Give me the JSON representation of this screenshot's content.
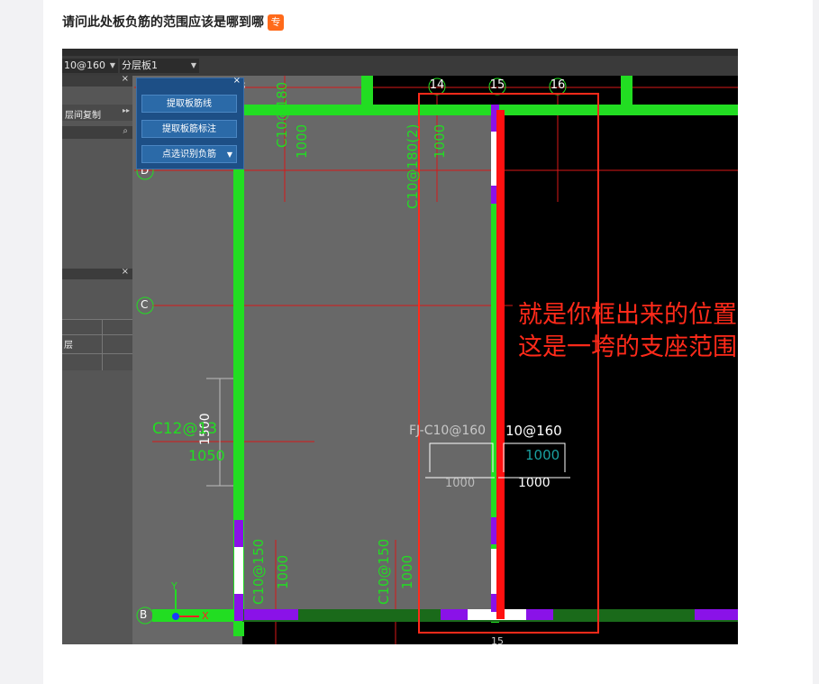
{
  "question": {
    "title": "请问此处板负筋的范围应该是哪到哪",
    "badge": "专"
  },
  "toolbar": {
    "dropdown_rebar": "10@160",
    "dropdown_layer": "分层板1"
  },
  "left_pane": {
    "item_copy": "层间复制",
    "row_label": "层"
  },
  "float_panel": {
    "btn_extract_line": "提取板筋线",
    "btn_extract_mark": "提取板筋标注",
    "btn_point_identify": "点选识别负筋"
  },
  "grid_labels": {
    "axis_14": "14",
    "axis_15": "15",
    "axis_16": "16",
    "axis_15_bottom": "15",
    "axis_3": "3",
    "axis_D": "D",
    "axis_C": "C",
    "axis_B": "B"
  },
  "cad_text": {
    "t1": "C10@180",
    "t2": "1000",
    "t3": "C10@180(2)",
    "t4": "1000",
    "t5": "C12@13",
    "t6": "1500",
    "t7": "1050",
    "t8": "FJ-C10@160",
    "t9": "10@160",
    "t10": "1000",
    "t11": "1000",
    "t12": "1000",
    "t13": "C10@150",
    "t14": "1000",
    "t15": "C10@150",
    "t16": "1000",
    "ucs_y": "Y",
    "ucs_x": "X"
  },
  "annotation": {
    "line1": "就是你框出来的位置",
    "line2": "这是一垮的支座范围"
  },
  "colors": {
    "cad_green": "#22dd22",
    "purple": "#8a12e8",
    "highlight_red": "#ff2a1a"
  }
}
